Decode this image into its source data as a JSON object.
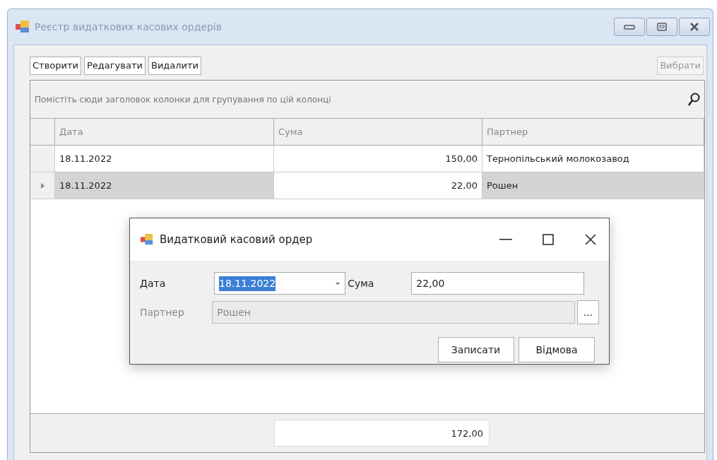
{
  "window": {
    "title": "Реєстр видаткових касових ордерів"
  },
  "toolbar": {
    "buttons": [
      "Створити",
      "Редагувати",
      "Видалити"
    ],
    "select_button": {
      "label": "Вибрати",
      "disabled": true
    }
  },
  "grid": {
    "group_panel_text": "Помістіть сюди заголовок колонки для групування по цій колонці",
    "columns": [
      "Дата",
      "Сума",
      "Партнер"
    ],
    "rows": [
      {
        "date": "18.11.2022",
        "amount": "150,00",
        "partner": "Тернопільський молокозавод",
        "selected": false
      },
      {
        "date": "18.11.2022",
        "amount": "22,00",
        "partner": "Рошен",
        "selected": true
      }
    ],
    "footer_total": "172,00"
  },
  "dialog": {
    "title": "Видатковий касовий ордер",
    "date_label": "Дата",
    "date_value": "18.11.2022",
    "date_value_highlighted": true,
    "amount_label": "Сума",
    "amount_value": "22,00",
    "partner_label": "Партнер",
    "partner_value": "Рошен",
    "partner_disabled": true,
    "browse_button": "...",
    "buttons": [
      "Записати",
      "Відмова"
    ]
  }
}
